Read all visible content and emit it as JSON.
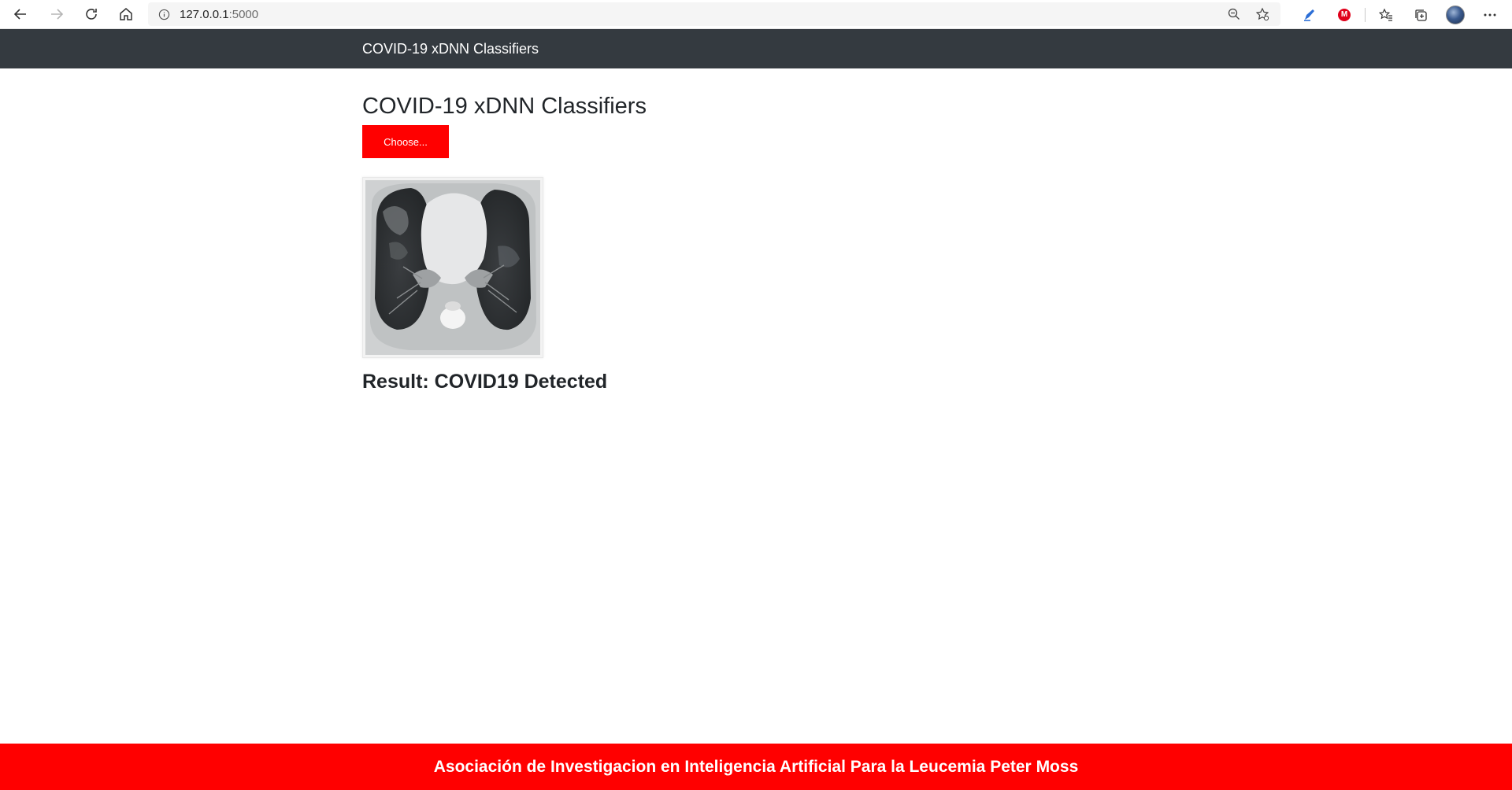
{
  "browser": {
    "url_host": "127.0.0.1",
    "url_port": ":5000",
    "icons": [
      "back-icon",
      "forward-icon",
      "refresh-icon",
      "home-icon",
      "info-icon",
      "zoom-out-icon",
      "add-favorite-icon",
      "pen-extension-icon",
      "red-extension-icon",
      "favorites-icon",
      "collections-icon",
      "profile-avatar",
      "more-icon"
    ],
    "red_extension_letter": "M"
  },
  "navbar": {
    "brand": "COVID-19 xDNN Classifiers"
  },
  "main": {
    "title": "COVID-19 xDNN Classifiers",
    "choose_label": "Choose...",
    "result_text": "Result: COVID19 Detected"
  },
  "footer": {
    "text": "Asociación de Investigacion en Inteligencia Artificial Para la Leucemia Peter Moss"
  },
  "colors": {
    "navbar": "#343a40",
    "accent": "#ff0000",
    "footer": "#ff0000"
  }
}
